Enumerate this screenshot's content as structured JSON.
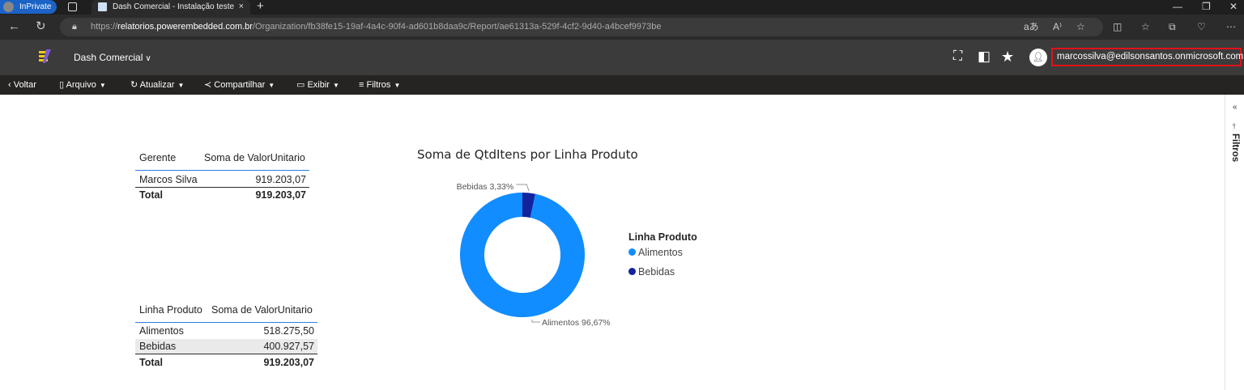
{
  "browser": {
    "inprivate_label": "InPrivate",
    "tab_title": "Dash Comercial - Instalação teste",
    "tab_close": "×",
    "new_tab": "+",
    "url_scheme": "https://",
    "url_host": "relatorios.powerembedded.com.br",
    "url_path": "/Organization/fb38fe15-19af-4a4c-90f4-ad601b8daa9c/Report/ae61313a-529f-4cf2-9d40-a4bcef9973be"
  },
  "app": {
    "report_title": "Dash Comercial",
    "user_email": "marcossilva@edilsonsantos.onmicrosoft.com"
  },
  "toolbar": {
    "back": "Voltar",
    "file": "Arquivo",
    "refresh": "Atualizar",
    "share": "Compartilhar",
    "view": "Exibir",
    "filters": "Filtros"
  },
  "filters_pane": {
    "label": "Filtros"
  },
  "table_gerente": {
    "headers": [
      "Gerente",
      "Soma de ValorUnitario"
    ],
    "rows": [
      [
        "Marcos Silva",
        "919.203,07"
      ]
    ],
    "total": [
      "Total",
      "919.203,07"
    ]
  },
  "table_linha": {
    "headers": [
      "Linha Produto",
      "Soma de ValorUnitario"
    ],
    "rows": [
      [
        "Alimentos",
        "518.275,50"
      ],
      [
        "Bebidas",
        "400.927,57"
      ]
    ],
    "total": [
      "Total",
      "919.203,07"
    ]
  },
  "chart_data": {
    "type": "pie",
    "variant": "donut",
    "title": "Soma de QtdItens por Linha Produto",
    "legend_title": "Linha Produto",
    "legend_position": "right",
    "categories": [
      "Alimentos",
      "Bebidas"
    ],
    "values": [
      96.67,
      3.33
    ],
    "data_labels": [
      "Alimentos 96,67%",
      "Bebidas 3,33%"
    ],
    "colors": [
      "#118dff",
      "#12239e"
    ]
  }
}
